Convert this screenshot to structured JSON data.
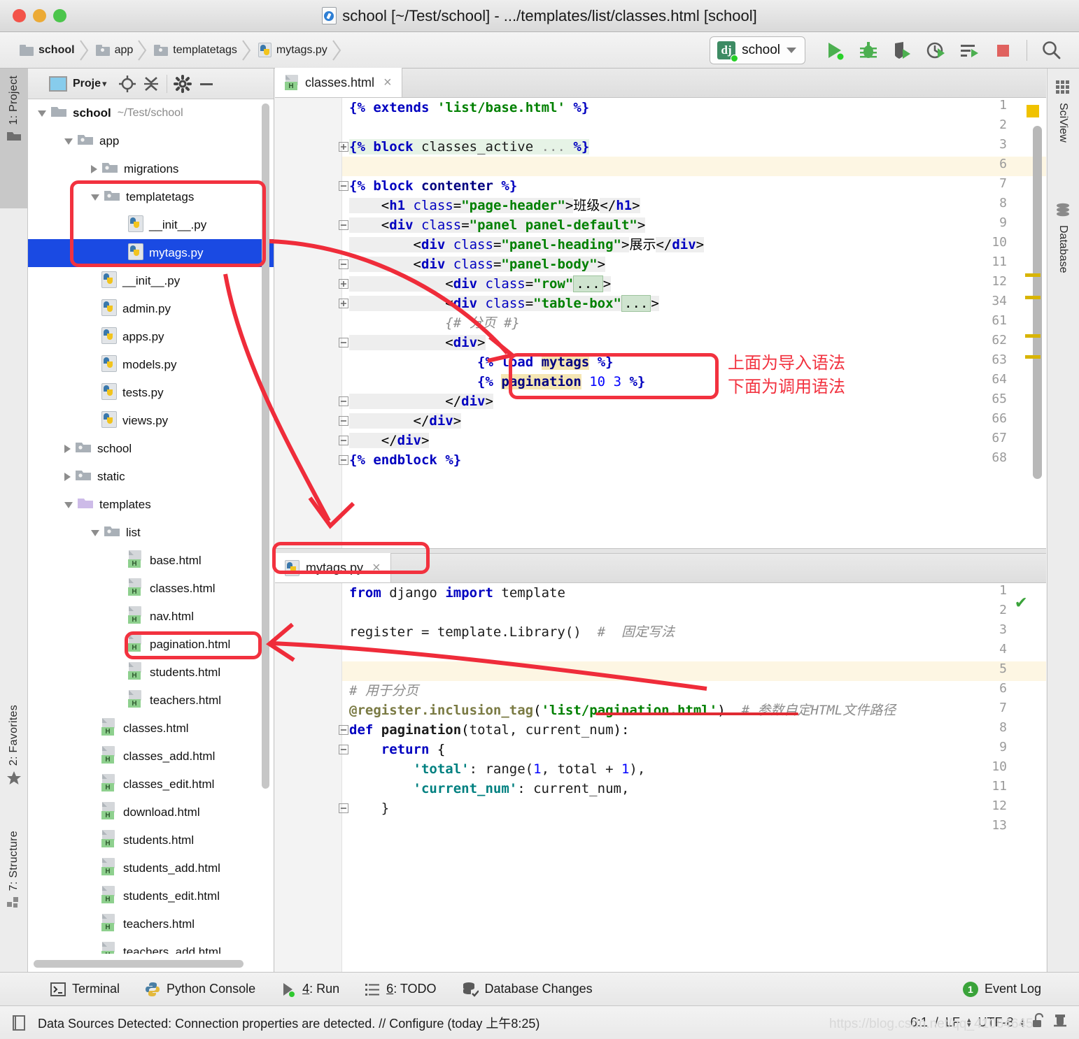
{
  "window": {
    "title": "school [~/Test/school] - .../templates/list/classes.html [school]",
    "title_icon": "pycharm-doc-icon"
  },
  "breadcrumbs": [
    {
      "label": "school",
      "icon": "folder-icon",
      "bold": true
    },
    {
      "label": "app",
      "icon": "folder-open-icon",
      "bold": false
    },
    {
      "label": "templatetags",
      "icon": "folder-open-icon",
      "bold": false
    },
    {
      "label": "mytags.py",
      "icon": "python-file-icon",
      "bold": false
    }
  ],
  "toolbar": {
    "run_config": "school",
    "run_config_icon": "django-icon",
    "buttons": [
      {
        "name": "run-button",
        "icon": "play-icon"
      },
      {
        "name": "debug-button",
        "icon": "bug-icon"
      },
      {
        "name": "run-coverage-button",
        "icon": "shield-play-icon"
      },
      {
        "name": "profile-button",
        "icon": "clock-play-icon"
      },
      {
        "name": "run-manage-task-button",
        "icon": "list-play-icon"
      },
      {
        "name": "stop-button",
        "icon": "stop-square-icon"
      },
      {
        "name": "search-everywhere-button",
        "icon": "search-icon"
      }
    ]
  },
  "left_strip": [
    {
      "label": "1: Project",
      "icon": "folder-icon",
      "active": true
    },
    {
      "label": "2: Favorites",
      "icon": "star-icon",
      "active": false
    },
    {
      "label": "7: Structure",
      "icon": "structure-icon",
      "active": false
    }
  ],
  "right_strip": [
    {
      "label": "SciView",
      "icon": "grid-icon"
    },
    {
      "label": "Database",
      "icon": "database-icon"
    }
  ],
  "project_panel": {
    "title": "Proje",
    "title_caret": "▾",
    "buttons": [
      {
        "name": "select-opened-file-button",
        "icon": "target-icon"
      },
      {
        "name": "collapse-all-button",
        "icon": "collapse-icon"
      },
      {
        "name": "settings-button",
        "icon": "gear-icon"
      },
      {
        "name": "hide-button",
        "icon": "minimize-icon"
      }
    ],
    "tree": [
      {
        "depth": 0,
        "twisty": "down",
        "icon": "folder-icon",
        "name": "school",
        "path": "~/Test/school",
        "bold": true,
        "selected": false
      },
      {
        "depth": 1,
        "twisty": "down",
        "icon": "folder-open-icon",
        "name": "app",
        "path": "",
        "bold": false,
        "selected": false
      },
      {
        "depth": 2,
        "twisty": "right",
        "icon": "folder-open-icon",
        "name": "migrations",
        "path": "",
        "bold": false,
        "selected": false
      },
      {
        "depth": 2,
        "twisty": "down",
        "icon": "folder-open-icon",
        "name": "templatetags",
        "path": "",
        "bold": false,
        "selected": false
      },
      {
        "depth": 3,
        "twisty": "none",
        "icon": "python-file-icon",
        "name": "__init__.py",
        "path": "",
        "bold": false,
        "selected": false
      },
      {
        "depth": 3,
        "twisty": "none",
        "icon": "python-file-icon",
        "name": "mytags.py",
        "path": "",
        "bold": false,
        "selected": true
      },
      {
        "depth": 2,
        "twisty": "none",
        "icon": "python-file-icon",
        "name": "__init__.py",
        "path": "",
        "bold": false,
        "selected": false
      },
      {
        "depth": 2,
        "twisty": "none",
        "icon": "python-file-icon",
        "name": "admin.py",
        "path": "",
        "bold": false,
        "selected": false
      },
      {
        "depth": 2,
        "twisty": "none",
        "icon": "python-file-icon",
        "name": "apps.py",
        "path": "",
        "bold": false,
        "selected": false
      },
      {
        "depth": 2,
        "twisty": "none",
        "icon": "python-file-icon",
        "name": "models.py",
        "path": "",
        "bold": false,
        "selected": false
      },
      {
        "depth": 2,
        "twisty": "none",
        "icon": "python-file-icon",
        "name": "tests.py",
        "path": "",
        "bold": false,
        "selected": false
      },
      {
        "depth": 2,
        "twisty": "none",
        "icon": "python-file-icon",
        "name": "views.py",
        "path": "",
        "bold": false,
        "selected": false
      },
      {
        "depth": 1,
        "twisty": "right",
        "icon": "folder-open-icon",
        "name": "school",
        "path": "",
        "bold": false,
        "selected": false
      },
      {
        "depth": 1,
        "twisty": "right",
        "icon": "folder-open-icon",
        "name": "static",
        "path": "",
        "bold": false,
        "selected": false
      },
      {
        "depth": 1,
        "twisty": "down",
        "icon": "template-folder-icon",
        "name": "templates",
        "path": "",
        "bold": false,
        "selected": false
      },
      {
        "depth": 2,
        "twisty": "down",
        "icon": "folder-open-icon",
        "name": "list",
        "path": "",
        "bold": false,
        "selected": false
      },
      {
        "depth": 3,
        "twisty": "none",
        "icon": "html-file-icon",
        "name": "base.html",
        "path": "",
        "bold": false,
        "selected": false
      },
      {
        "depth": 3,
        "twisty": "none",
        "icon": "html-file-icon",
        "name": "classes.html",
        "path": "",
        "bold": false,
        "selected": false
      },
      {
        "depth": 3,
        "twisty": "none",
        "icon": "html-file-icon",
        "name": "nav.html",
        "path": "",
        "bold": false,
        "selected": false
      },
      {
        "depth": 3,
        "twisty": "none",
        "icon": "html-file-icon",
        "name": "pagination.html",
        "path": "",
        "bold": false,
        "selected": false
      },
      {
        "depth": 3,
        "twisty": "none",
        "icon": "html-file-icon",
        "name": "students.html",
        "path": "",
        "bold": false,
        "selected": false
      },
      {
        "depth": 3,
        "twisty": "none",
        "icon": "html-file-icon",
        "name": "teachers.html",
        "path": "",
        "bold": false,
        "selected": false
      },
      {
        "depth": 2,
        "twisty": "none",
        "icon": "html-file-icon",
        "name": "classes.html",
        "path": "",
        "bold": false,
        "selected": false
      },
      {
        "depth": 2,
        "twisty": "none",
        "icon": "html-file-icon",
        "name": "classes_add.html",
        "path": "",
        "bold": false,
        "selected": false
      },
      {
        "depth": 2,
        "twisty": "none",
        "icon": "html-file-icon",
        "name": "classes_edit.html",
        "path": "",
        "bold": false,
        "selected": false
      },
      {
        "depth": 2,
        "twisty": "none",
        "icon": "html-file-icon",
        "name": "download.html",
        "path": "",
        "bold": false,
        "selected": false
      },
      {
        "depth": 2,
        "twisty": "none",
        "icon": "html-file-icon",
        "name": "students.html",
        "path": "",
        "bold": false,
        "selected": false
      },
      {
        "depth": 2,
        "twisty": "none",
        "icon": "html-file-icon",
        "name": "students_add.html",
        "path": "",
        "bold": false,
        "selected": false
      },
      {
        "depth": 2,
        "twisty": "none",
        "icon": "html-file-icon",
        "name": "students_edit.html",
        "path": "",
        "bold": false,
        "selected": false
      },
      {
        "depth": 2,
        "twisty": "none",
        "icon": "html-file-icon",
        "name": "teachers.html",
        "path": "",
        "bold": false,
        "selected": false
      },
      {
        "depth": 2,
        "twisty": "none",
        "icon": "html-file-icon",
        "name": "teachers_add.html",
        "path": "",
        "bold": false,
        "selected": false
      }
    ]
  },
  "editor_top": {
    "tab": {
      "label": "classes.html",
      "icon": "html-file-icon",
      "close": "×"
    },
    "lines": [
      {
        "num": "1",
        "fold": "",
        "highlight": false
      },
      {
        "num": "2",
        "fold": "",
        "highlight": false
      },
      {
        "num": "3",
        "fold": "+",
        "highlight": false
      },
      {
        "num": "6",
        "fold": "",
        "highlight": true
      },
      {
        "num": "7",
        "fold": "-",
        "highlight": false
      },
      {
        "num": "8",
        "fold": "",
        "highlight": false
      },
      {
        "num": "9",
        "fold": "-",
        "highlight": false
      },
      {
        "num": "10",
        "fold": "",
        "highlight": false
      },
      {
        "num": "11",
        "fold": "-",
        "highlight": false
      },
      {
        "num": "12",
        "fold": "+",
        "highlight": false
      },
      {
        "num": "34",
        "fold": "+",
        "highlight": false
      },
      {
        "num": "61",
        "fold": "",
        "highlight": false
      },
      {
        "num": "62",
        "fold": "-",
        "highlight": false
      },
      {
        "num": "63",
        "fold": "",
        "highlight": false
      },
      {
        "num": "64",
        "fold": "",
        "highlight": false
      },
      {
        "num": "65",
        "fold": "-",
        "highlight": false
      },
      {
        "num": "66",
        "fold": "-",
        "highlight": false
      },
      {
        "num": "67",
        "fold": "-",
        "highlight": false
      },
      {
        "num": "68",
        "fold": "-",
        "highlight": false
      }
    ],
    "code": [
      "{% extends 'list/base.html' %}",
      "",
      "{% block classes_active ... %}",
      "",
      "{% block contenter %}",
      "    <h1 class=\"page-header\">班级</h1>",
      "    <div class=\"panel panel-default\">",
      "        <div class=\"panel-heading\">展示</div>",
      "        <div class=\"panel-body\">",
      "            <div class=\"row\"...>",
      "            <div class=\"table-box\"...>",
      "            {# 分页 #}",
      "            <div>",
      "                {% load mytags %}",
      "                {% pagination 10 3 %}",
      "            </div>",
      "        </div>",
      "    </div>",
      "{% endblock %}"
    ]
  },
  "editor_bottom": {
    "tab": {
      "label": "mytags.py",
      "icon": "python-file-icon",
      "close": "×"
    },
    "lines": [
      {
        "num": "1",
        "fold": "",
        "highlight": false
      },
      {
        "num": "2",
        "fold": "",
        "highlight": false
      },
      {
        "num": "3",
        "fold": "",
        "highlight": false
      },
      {
        "num": "4",
        "fold": "",
        "highlight": false
      },
      {
        "num": "5",
        "fold": "",
        "highlight": true
      },
      {
        "num": "6",
        "fold": "",
        "highlight": false
      },
      {
        "num": "7",
        "fold": "",
        "highlight": false
      },
      {
        "num": "8",
        "fold": "-",
        "highlight": false
      },
      {
        "num": "9",
        "fold": "-",
        "highlight": false
      },
      {
        "num": "10",
        "fold": "",
        "highlight": false
      },
      {
        "num": "11",
        "fold": "",
        "highlight": false
      },
      {
        "num": "12",
        "fold": "-",
        "highlight": false
      },
      {
        "num": "13",
        "fold": "",
        "highlight": false
      }
    ],
    "code": [
      "from django import template",
      "",
      "register = template.Library()  # 固定写法",
      "",
      "",
      "# 用于分页",
      "@register.inclusion_tag('list/pagination.html')  # 参数自定HTML文件路径",
      "def pagination(total, current_num):",
      "    return {",
      "        'total': range(1, total + 1),",
      "        'current_num': current_num,",
      "    }",
      ""
    ],
    "inspection_status": "✔"
  },
  "annotations": {
    "note_line1": "上面为导入语法",
    "note_line2": "下面为调用语法"
  },
  "tool_windows": [
    {
      "label": "Terminal",
      "icon": "terminal-icon",
      "num": ""
    },
    {
      "label": "Python Console",
      "icon": "python-icon",
      "num": ""
    },
    {
      "label": "4: Run",
      "icon": "play-icon",
      "num": "4"
    },
    {
      "label": "6: TODO",
      "icon": "todo-list-icon",
      "num": "6"
    },
    {
      "label": "Database Changes",
      "icon": "database-changes-icon",
      "num": ""
    },
    {
      "label": "Event Log",
      "icon": "event-log-badge",
      "num": "1"
    }
  ],
  "statusbar": {
    "message": "Data Sources Detected: Connection properties are detected. // Configure (today 上午8:25)",
    "caret": "6:1",
    "line_sep": "LF",
    "encoding": "UTF-8",
    "lock_icon": "unlocked-icon",
    "watermark": "https://blog.csdn.net/qq_41064645"
  }
}
